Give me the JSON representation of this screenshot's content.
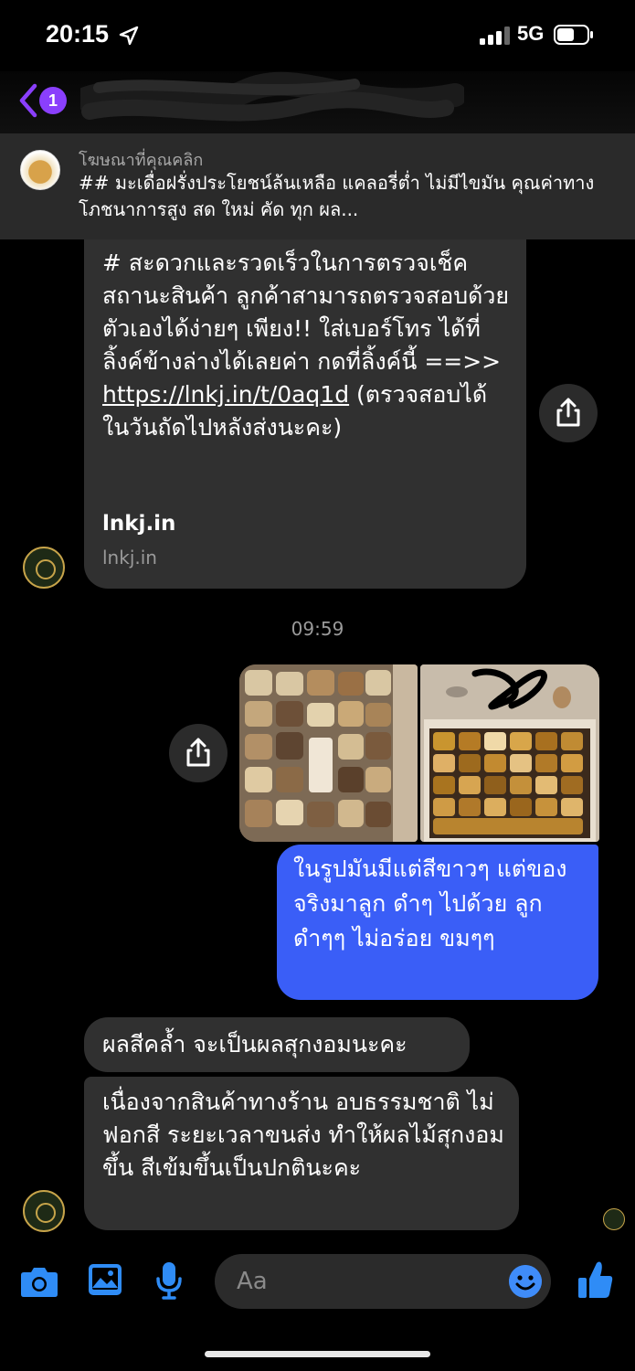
{
  "status_bar": {
    "time": "20:15",
    "network": "5G"
  },
  "header": {
    "back_badge_count": "1",
    "contact_name": ""
  },
  "ad_banner": {
    "label": "โฆษณาที่คุณคลิก",
    "text": "## มะเดื่อฝรั่งประโยชน์ล้นเหลือ แคลอรี่ต่ำ ไม่มีไขมัน คุณค่าทางโภชนาการสูง สด ใหม่ คัด ทุก ผล..."
  },
  "messages": {
    "link_message": {
      "text_before": "# สะดวกและรวดเร็วในการตรวจเช็คสถานะสินค้า ลูกค้าสามารถตรวจสอบด้วยตัวเองได้ง่ายๆ เพียง!! ใส่เบอร์โทร ได้ที่ลิ้งค์ข้างล่างได้เลยค่า กดที่ลิ้งค์นี้ ==>> ",
      "url": "https://lnkj.in/t/0aq1d",
      "text_after": " (ตรวจสอบได้ในวันถัดไปหลังส่งนะคะ)",
      "preview_title": "lnkj.in",
      "preview_domain": "lnkj.in"
    },
    "timestamp": "09:59",
    "sent_message": "ในรูปมันมีแต่สีขาวๆ แต่ของจริงมาลูก ดำๆ ไปด้วย ลูกดำๆๆ ไม่อร่อย ขมๆๆ",
    "reply_1": "ผลสีคล้ำ จะเป็นผลสุกงอมนะคะ",
    "reply_2": "เนื่องจากสินค้าทางร้าน อบธรรมชาติ ไม่ฟอกสี ระยะเวลาขนส่ง ทำให้ผลไม้สุกงอมขึ้น สีเข้มขึ้นเป็นปกตินะคะ"
  },
  "composer": {
    "placeholder": "Aa",
    "icons": [
      "camera-icon",
      "image-icon",
      "microphone-icon",
      "emoji-icon",
      "thumbs-up-icon"
    ]
  },
  "colors": {
    "accent_purple": "#8a3ffc",
    "sent_bubble": "#3a5ef7",
    "received_bubble": "#303030",
    "composer_icon": "#2f8cf6"
  }
}
